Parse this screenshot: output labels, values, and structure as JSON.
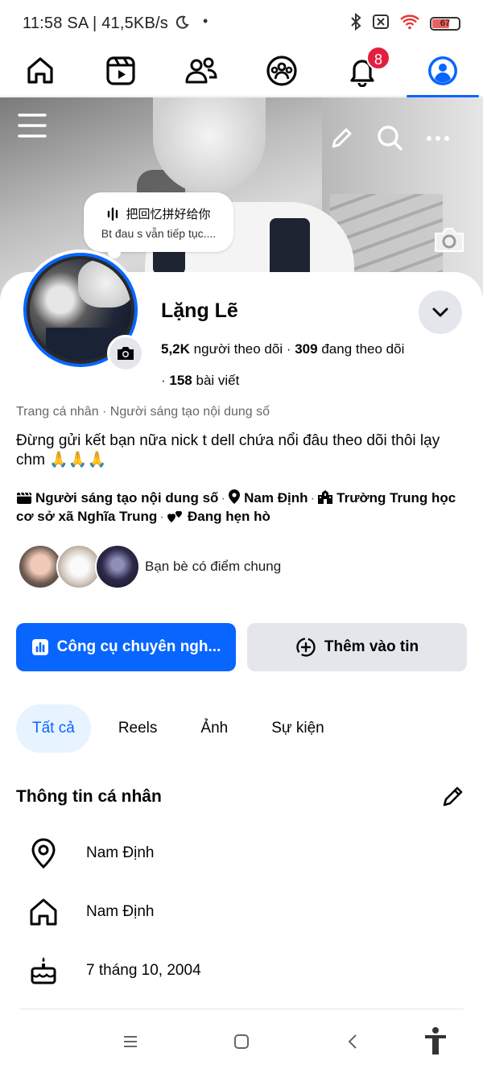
{
  "status_bar": {
    "time": "11:58 SA | 41,5KB/s",
    "dot": "•",
    "battery": "67"
  },
  "nav": {
    "tabs": [
      "home-icon",
      "reels-icon",
      "friends-icon",
      "groups-icon",
      "notifications-icon",
      "profile-icon"
    ],
    "notifications_badge": "8",
    "active_tab": "profile"
  },
  "cover": {
    "note_title": "把回忆拼好给你",
    "note_subtitle": "Bt đau s vẫn tiếp tục...."
  },
  "profile": {
    "name": "Lặng Lẽ",
    "followers_count": "5,2K",
    "followers_label": "người theo dõi",
    "following_count": "309",
    "following_label": "đang theo dõi",
    "posts_count": "158",
    "posts_label": "bài viết",
    "category": "Trang cá nhân · Người sáng tạo nội dung số",
    "bio": "Đừng gửi kết bạn nữa nick t dell chứa nổi đâu theo dõi thôi lạy chm 🙏🙏🙏",
    "details": {
      "creator": "Người sáng tạo nội dung số",
      "location": "Nam Định",
      "school": "Trường Trung học cơ sở xã Nghĩa Trung",
      "relationship": "Đang hẹn hò"
    },
    "mutual_label": "Bạn bè có điểm chung"
  },
  "actions": {
    "primary": "Công cụ chuyên ngh...",
    "secondary": "Thêm vào tin"
  },
  "filters": [
    "Tất cả",
    "Reels",
    "Ảnh",
    "Sự kiện"
  ],
  "about": {
    "title": "Thông tin cá nhân",
    "items": [
      {
        "icon": "location-pin-icon",
        "value": "Nam Định"
      },
      {
        "icon": "house-icon",
        "value": "Nam Định"
      },
      {
        "icon": "birthday-cake-icon",
        "value": "7 tháng 10, 2004"
      }
    ]
  },
  "colors": {
    "brand_blue": "#0866ff",
    "badge_red": "#e41e3f",
    "button_gray": "#e4e6eb",
    "chip_active_bg": "#e7f3ff"
  }
}
